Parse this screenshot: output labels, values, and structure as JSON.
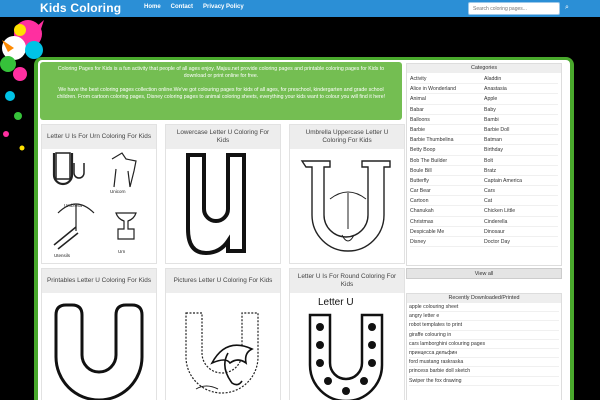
{
  "header": {
    "brand": "Kids Coloring",
    "nav": [
      "Home",
      "Contact",
      "Privacy Policy"
    ],
    "search_placeholder": "Search coloring pages..."
  },
  "intro": {
    "p1": "Coloring Pages for Kids is a fun activity that people of all ages enjoy. Majuu.net provide coloring pages and printable coloring pages for Kids to download or print online for free.",
    "p2": "We have the best coloring pages collection online.We've got colouring pages for kids of all ages, for preschool, kindergarten and grade school children. From cartoon coloring pages, Disney coloring pages to animal coloring sheets, everything your kids want to colour you will find it here!"
  },
  "cards": [
    {
      "title": "Letter U Is For Urn Coloring For Kids",
      "image": "letter-u-urn"
    },
    {
      "title": "Lowercase Letter U Coloring For Kids",
      "image": "lowercase-u"
    },
    {
      "title": "Umbrella Uppercase Letter U Coloring For Kids",
      "image": "umbrella-u"
    },
    {
      "title": "Printables Letter U Coloring For Kids",
      "image": "bubble-u"
    },
    {
      "title": "Pictures Letter U Coloring For Kids",
      "image": "umbrella-picture"
    },
    {
      "title": "Letter U Is For Round Coloring For Kids",
      "image": "letter-u-dots",
      "image_text": "Letter U"
    }
  ],
  "categories": {
    "heading": "Categories",
    "items": [
      "Activity",
      "Aladdin",
      "Alice in Wonderland",
      "Anastasia",
      "Animal",
      "Apple",
      "Babar",
      "Baby",
      "Balloons",
      "Bambi",
      "Barbie",
      "Barbie Doll",
      "Barbie Thumbelina",
      "Batman",
      "Betty Boop",
      "Birthday",
      "Bob The Builder",
      "Bolt",
      "Boule Bill",
      "Bratz",
      "Butterfly",
      "Captain America",
      "Car Bear",
      "Cars",
      "Cartoon",
      "Cat",
      "Chanukah",
      "Chicken Little",
      "Christmas",
      "Cinderella",
      "Despicable Me",
      "Dinosaur",
      "Disney",
      "Doctor Day"
    ],
    "view_all": "View all"
  },
  "urn_labels": [
    "Unicorn",
    "Umbrella",
    "Utensils",
    "Urn"
  ],
  "recent": {
    "heading": "Recently Downloaded/Printed",
    "items": [
      "apple colouring sheet",
      "angry letter e",
      "robot templates to print",
      "giraffe colouring in",
      "cars lamborghini colouring pages",
      "принцесса дельфин",
      "ford mustang raskraska",
      "princess barbie doll sketch",
      "Swiper the fox drawing"
    ]
  },
  "colors": {
    "nav": "#2b8fd6",
    "frame": "#49a82c",
    "intro": "#74be52"
  }
}
